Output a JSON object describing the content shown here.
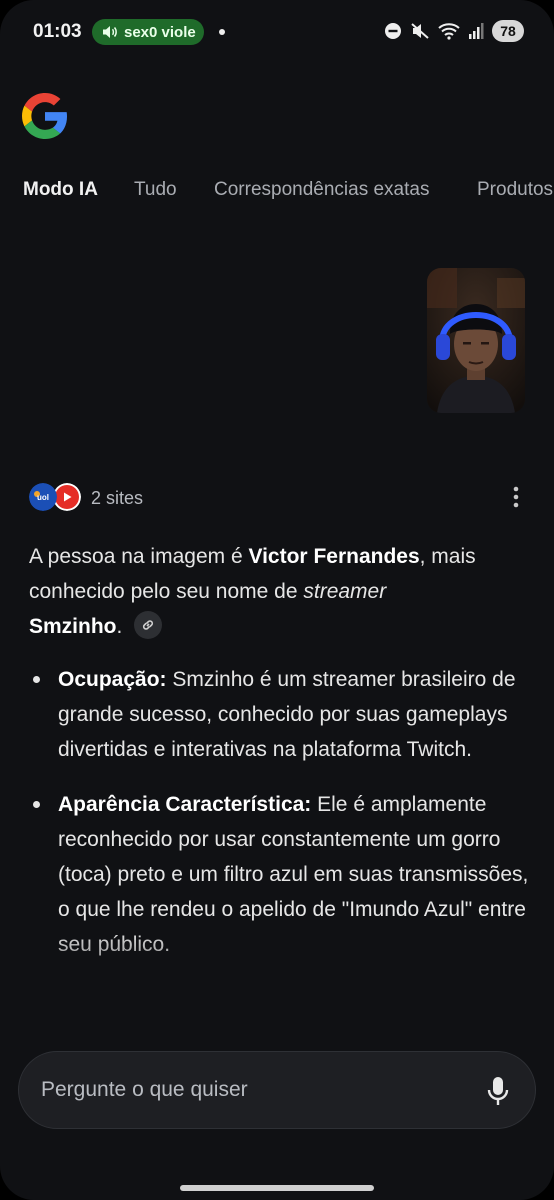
{
  "status_bar": {
    "time": "01:03",
    "media_text": "sex0 viole",
    "battery": "78"
  },
  "tabs": [
    {
      "label": "Modo IA",
      "active": true
    },
    {
      "label": "Tudo",
      "active": false
    },
    {
      "label": "Correspondências exatas",
      "active": false
    },
    {
      "label": "Produtos",
      "active": false
    }
  ],
  "sources": {
    "count_label": "2 sites",
    "icons": [
      "uol-icon",
      "youtube-icon"
    ]
  },
  "answer": {
    "intro_prefix": "A pessoa na imagem é ",
    "name": "Victor Fernandes",
    "intro_mid": ", mais conhecido pelo seu nome de ",
    "intro_italic": "streamer",
    "nickname": "Smzinho",
    "intro_end": "."
  },
  "bullets": [
    {
      "title": "Ocupação:",
      "text": " Smzinho é um streamer brasileiro de grande sucesso, conhecido por suas gameplays divertidas e interativas na plataforma Twitch."
    },
    {
      "title": "Aparência Característica:",
      "text": " Ele é amplamente reconhecido por usar constantemente um gorro (toca) preto e um filtro azul em suas transmissões, o que lhe rendeu o apelido de \"Imundo Azul\" entre seu público."
    }
  ],
  "ask": {
    "placeholder": "Pergunte o que quiser"
  },
  "colors": {
    "background": "#101114",
    "media_pill": "#1f6b2a",
    "google_blue": "#4285F4",
    "google_red": "#EA4335",
    "google_yellow": "#FBBC05",
    "google_green": "#34A853"
  }
}
